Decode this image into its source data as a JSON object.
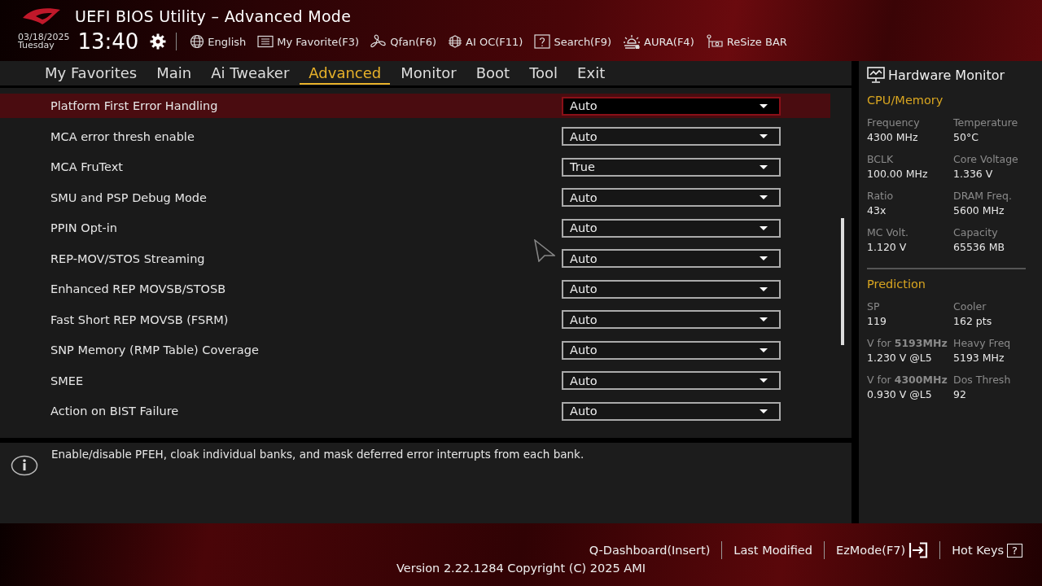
{
  "window": {
    "title": "UEFI BIOS Utility – Advanced Mode"
  },
  "header": {
    "date": "03/18/2025",
    "day": "Tuesday",
    "time": "13:40",
    "tools": [
      {
        "kind": "globe",
        "label": "English"
      },
      {
        "kind": "favorite",
        "label": "My Favorite(F3)"
      },
      {
        "kind": "fan",
        "label": "Qfan(F6)"
      },
      {
        "kind": "chip",
        "label": "AI OC(F11)"
      },
      {
        "kind": "search",
        "label": "Search(F9)"
      },
      {
        "kind": "aura",
        "label": "AURA(F4)"
      },
      {
        "kind": "card",
        "label": "ReSize BAR"
      }
    ]
  },
  "tabs": [
    {
      "label": "My Favorites",
      "selected": false
    },
    {
      "label": "Main",
      "selected": false
    },
    {
      "label": "Ai Tweaker",
      "selected": false
    },
    {
      "label": "Advanced",
      "selected": true
    },
    {
      "label": "Monitor",
      "selected": false
    },
    {
      "label": "Boot",
      "selected": false
    },
    {
      "label": "Tool",
      "selected": false
    },
    {
      "label": "Exit",
      "selected": false
    }
  ],
  "settings": [
    {
      "name": "Platform First Error Handling",
      "value": "Auto",
      "selected": true
    },
    {
      "name": "MCA error thresh enable",
      "value": "Auto",
      "selected": false
    },
    {
      "name": "MCA FruText",
      "value": "True",
      "selected": false
    },
    {
      "name": "SMU and PSP Debug Mode",
      "value": "Auto",
      "selected": false
    },
    {
      "name": "PPIN Opt-in",
      "value": "Auto",
      "selected": false
    },
    {
      "name": "REP-MOV/STOS Streaming",
      "value": "Auto",
      "selected": false
    },
    {
      "name": "Enhanced REP MOVSB/STOSB",
      "value": "Auto",
      "selected": false
    },
    {
      "name": "Fast Short REP MOVSB (FSRM)",
      "value": "Auto",
      "selected": false
    },
    {
      "name": "SNP Memory (RMP Table) Coverage",
      "value": "Auto",
      "selected": false
    },
    {
      "name": "SMEE",
      "value": "Auto",
      "selected": false
    },
    {
      "name": "Action on BIST Failure",
      "value": "Auto",
      "selected": false
    }
  ],
  "help_text": "Enable/disable PFEH, cloak individual banks, and mask deferred error interrupts from each bank.",
  "hardware_monitor": {
    "title": "Hardware Monitor",
    "sections": [
      {
        "title": "CPU/Memory",
        "items": [
          {
            "label": "Frequency",
            "value": "4300 MHz"
          },
          {
            "label": "Temperature",
            "value": "50°C"
          },
          {
            "label": "BCLK",
            "value": "100.00 MHz"
          },
          {
            "label": "Core Voltage",
            "value": "1.336 V"
          },
          {
            "label": "Ratio",
            "value": "43x"
          },
          {
            "label": "DRAM Freq.",
            "value": "5600 MHz"
          },
          {
            "label": "MC Volt.",
            "value": "1.120 V"
          },
          {
            "label": "Capacity",
            "value": "65536 MB"
          }
        ]
      },
      {
        "title": "Prediction",
        "items": [
          {
            "label": "SP",
            "value": "119"
          },
          {
            "label": "Cooler",
            "value": "162 pts"
          },
          {
            "label": "V for **5193MHz**",
            "value": "1.230 V @L5"
          },
          {
            "label": "Heavy Freq",
            "value": "5193 MHz"
          },
          {
            "label": "V for **4300MHz**",
            "value": "0.930 V @L5"
          },
          {
            "label": "Dos Thresh",
            "value": "92"
          }
        ]
      }
    ]
  },
  "footer": {
    "actions": [
      {
        "kind": "text",
        "label": "Q-Dashboard(Insert)"
      },
      {
        "kind": "text",
        "label": "Last Modified"
      },
      {
        "kind": "exit",
        "label": "EzMode(F7)"
      },
      {
        "kind": "help",
        "label": "Hot Keys"
      }
    ],
    "help_key": "?",
    "version": "Version 2.22.1284 Copyright (C) 2025 AMI"
  }
}
